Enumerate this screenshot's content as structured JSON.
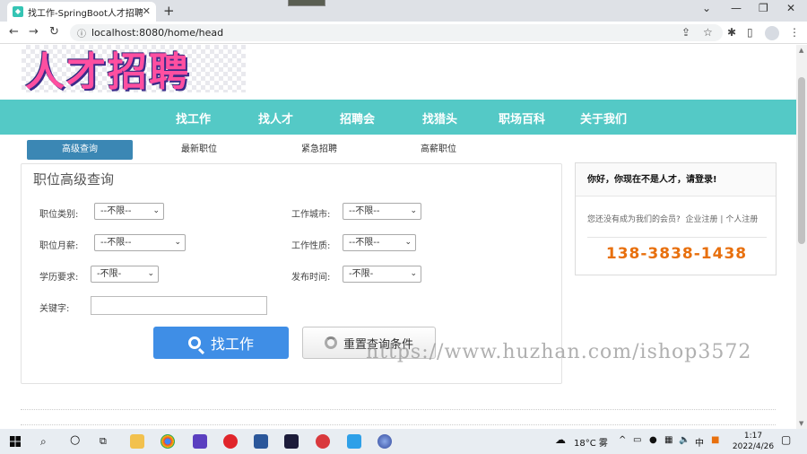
{
  "browser": {
    "tab_title": "找工作-SpringBoot人才招聘系统",
    "new_tab_label": "+",
    "url": "localhost:8080/home/head",
    "window_controls": [
      "⌄",
      "—",
      "❐",
      "✕"
    ]
  },
  "site": {
    "logo_text": "人才招聘",
    "nav": [
      "找工作",
      "找人才",
      "招聘会",
      "找猎头",
      "职场百科",
      "关于我们"
    ],
    "subtabs": [
      "高级查询",
      "最新职位",
      "紧急招聘",
      "高薪职位"
    ]
  },
  "search": {
    "title": "职位高级查询",
    "fields": [
      {
        "label": "职位类别:",
        "value": "--不限--"
      },
      {
        "label": "工作城市:",
        "value": "--不限--"
      },
      {
        "label": "职位月薪:",
        "value": "--不限--"
      },
      {
        "label": "工作性质:",
        "value": "--不限--"
      },
      {
        "label": "学历要求:",
        "value": "-不限-"
      },
      {
        "label": "发布时间:",
        "value": "-不限-"
      }
    ],
    "keyword_label": "关键字:",
    "keyword_value": "",
    "find_button": "找工作",
    "reset_button": "重置查询条件"
  },
  "login_box": {
    "greeting": "你好，你现在不是人才，请登录!",
    "tip": "您还没有成为我们的会员?",
    "company_register": "企业注册",
    "divider": "|",
    "person_register": "个人注册",
    "phone": "138-3838-1438"
  },
  "watermark": "https://www.huzhan.com/ishop3572",
  "taskbar": {
    "weather": "18°C 雾",
    "time": "1:17",
    "date": "2022/4/26",
    "ime": "中"
  }
}
